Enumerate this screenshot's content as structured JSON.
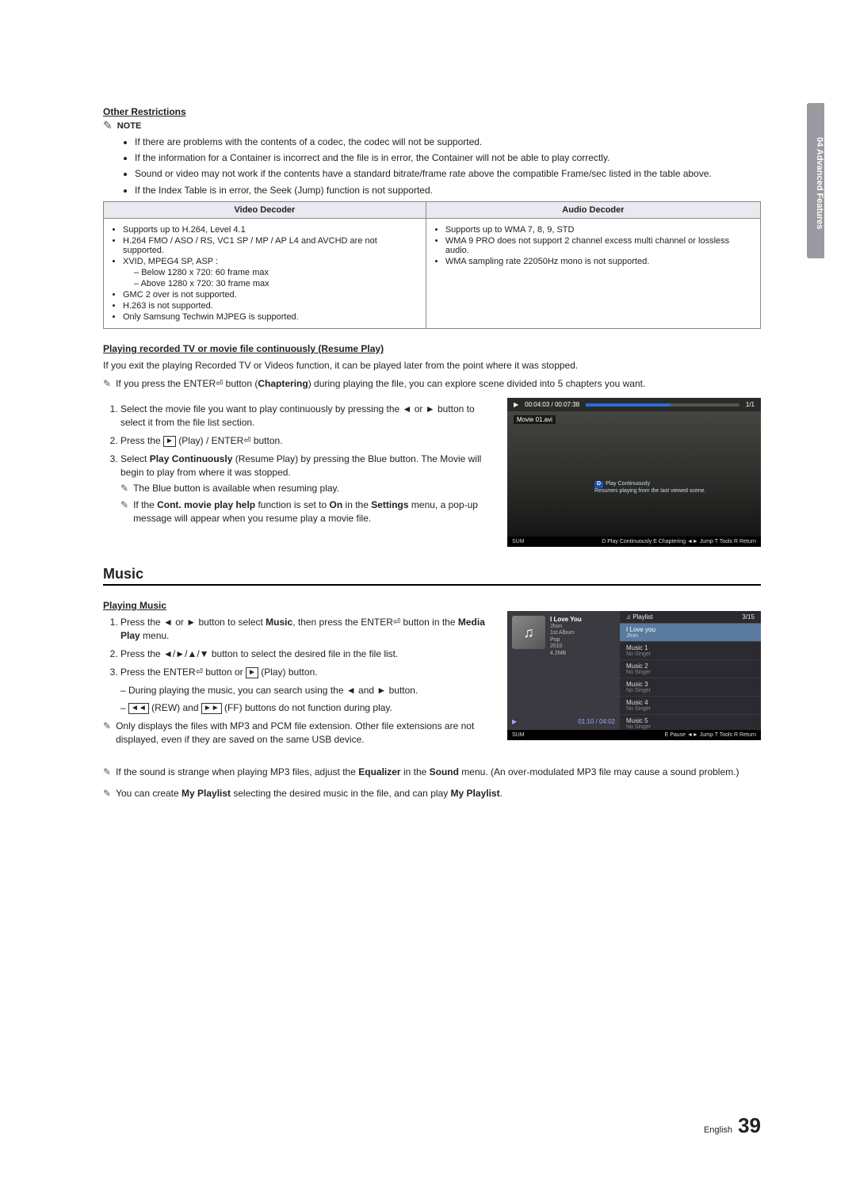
{
  "side_tab": "04  Advanced Features",
  "other_restrictions": {
    "heading": "Other Restrictions",
    "note_label": "NOTE",
    "bullets": [
      "If there are problems with the contents of a codec, the codec will not be supported.",
      "If the information for a Container is incorrect and the file is in error, the Container will not be able to play correctly.",
      "Sound or video may not work if the contents have a standard bitrate/frame rate above the compatible Frame/sec listed in the table above.",
      "If the Index Table is in error, the Seek (Jump) function is not supported."
    ]
  },
  "codec_table": {
    "headers": [
      "Video Decoder",
      "Audio Decoder"
    ],
    "video": {
      "b1": "Supports up to H.264, Level 4.1",
      "b2": "H.264 FMO / ASO / RS, VC1 SP / MP / AP L4 and AVCHD are not supported.",
      "b3": "XVID, MPEG4 SP, ASP :",
      "b3a": "Below 1280 x 720: 60 frame max",
      "b3b": "Above 1280 x 720: 30 frame max",
      "b4": "GMC 2 over is not supported.",
      "b5": "H.263 is not supported.",
      "b6": "Only Samsung Techwin MJPEG is supported."
    },
    "audio": {
      "b1": "Supports up to WMA 7, 8, 9, STD",
      "b2": "WMA 9 PRO does not support 2 channel excess multi channel or lossless audio.",
      "b3": "WMA sampling rate 22050Hz mono is not supported."
    }
  },
  "resume": {
    "heading": "Playing recorded TV or movie file continuously (Resume Play)",
    "intro": "If you exit the playing Recorded TV or Videos function, it can be played later from the point where it was stopped.",
    "note1_pre": "If you press the ENTER",
    "note1_mid": " button (",
    "note1_bold": "Chaptering",
    "note1_post": ") during playing the file, you can explore scene divided into 5 chapters you want.",
    "step1": "Select the movie file you want to play continuously by pressing the ◄ or ► button to select it from the file list section.",
    "step2_pre": "Press the ",
    "step2_play": "►",
    "step2_mid": " (Play) / ENTER",
    "step2_post": " button.",
    "step3_pre": "Select ",
    "step3_bold": "Play Continuously",
    "step3_post": " (Resume Play) by pressing the Blue button. The Movie will begin to play from where it was stopped.",
    "sub1": "The Blue button is available when resuming play.",
    "sub2_pre": "If the ",
    "sub2_b1": "Cont. movie play help",
    "sub2_mid1": " function is set to ",
    "sub2_b2": "On",
    "sub2_mid2": " in the ",
    "sub2_b3": "Settings",
    "sub2_post": " menu, a pop-up message will appear when you resume play a movie file."
  },
  "video_shot": {
    "time": "00:04:03 / 00:07:38",
    "page": "1/1",
    "file": "Movie 01.avi",
    "tip_title": "Play Continuously",
    "tip_body": "Resumes playing from the last viewed scene.",
    "sum": "SUM",
    "hints": "D Play Continuously  E Chaptering  ◄► Jump  T Tools  R Return"
  },
  "music": {
    "heading": "Music",
    "sub": "Playing Music",
    "step1_pre": "Press the ◄ or ► button to select ",
    "step1_b1": "Music",
    "step1_mid": ", then press the ENTER",
    "step1_mid2": " button in the ",
    "step1_b2": "Media Play",
    "step1_post": " menu.",
    "step2": "Press the ◄/►/▲/▼ button to select the desired file in the file list.",
    "step3_pre": "Press the ENTER",
    "step3_mid": " button or ",
    "step3_play": "►",
    "step3_post": " (Play) button.",
    "step3a": "During playing the music, you can search using the ◄ and ► button.",
    "step3b_pre": "",
    "step3b_rew": "◄◄",
    "step3b_mid": " (REW) and ",
    "step3b_ff": "►►",
    "step3b_post": " (FF) buttons do not function during play.",
    "note1": "Only displays the files with MP3 and PCM file extension. Other file extensions are not displayed, even if they are saved on the same USB device.",
    "note2_pre": "If the sound is strange when playing MP3 files, adjust the ",
    "note2_b1": "Equalizer",
    "note2_mid": " in the ",
    "note2_b2": "Sound",
    "note2_post": " menu. (An over-modulated MP3 file may cause a sound problem.)",
    "note3_pre": "You can create ",
    "note3_b1": "My Playlist",
    "note3_mid": " selecting the desired music in the file, and can play ",
    "note3_b2": "My Playlist",
    "note3_post": "."
  },
  "music_shot": {
    "playlist_label": "Playlist",
    "count": "3/15",
    "now_title": "I Love You",
    "now_artist": "Jhon",
    "album": "1st Album",
    "genre": "Pop",
    "year": "2010",
    "size": "4.2MB",
    "time": "01:10 / 04:02",
    "items": [
      {
        "t": "I Love you",
        "s": "Jhon"
      },
      {
        "t": "Music 1",
        "s": "No Singer"
      },
      {
        "t": "Music 2",
        "s": "No Singer"
      },
      {
        "t": "Music 3",
        "s": "No Singer"
      },
      {
        "t": "Music 4",
        "s": "No Singer"
      },
      {
        "t": "Music 5",
        "s": "No Singer"
      }
    ],
    "sum": "SUM",
    "hints": "E Pause  ◄► Jump  T Tools  R Return"
  },
  "footer": {
    "lang": "English",
    "page": "39"
  }
}
